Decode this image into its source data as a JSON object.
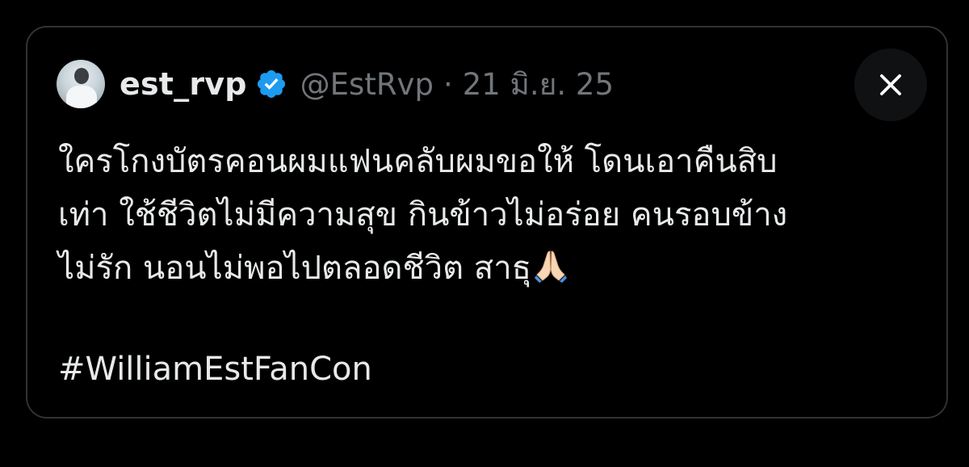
{
  "tweet": {
    "author": {
      "display_name": "est_rvp",
      "handle": "@EstRvp",
      "verified": true,
      "avatar_icon": "profile-photo"
    },
    "separator": "·",
    "date": "21 มิ.ย. 25",
    "text_lines": [
      "ใครโกงบัตรคอนผมแฟนคลับผมขอให้ โดนเอาคืนสิบ",
      "เท่า ใช้ชีวิตไม่มีความสุข กินข้าวไม่อร่อย คนรอบข้าง",
      "ไม่รัก นอนไม่พอไปตลอดชีวิต สาธุ"
    ],
    "emoji": "folded-hands-emoji",
    "hashtag": "#WilliamEstFanCon"
  },
  "controls": {
    "close_icon": "close-icon"
  },
  "colors": {
    "background": "#000000",
    "border": "#2f3336",
    "text_primary": "#e7e9ea",
    "text_secondary": "#71767b",
    "verified_blue": "#1d9bf0",
    "close_bg": "#0f1113"
  }
}
